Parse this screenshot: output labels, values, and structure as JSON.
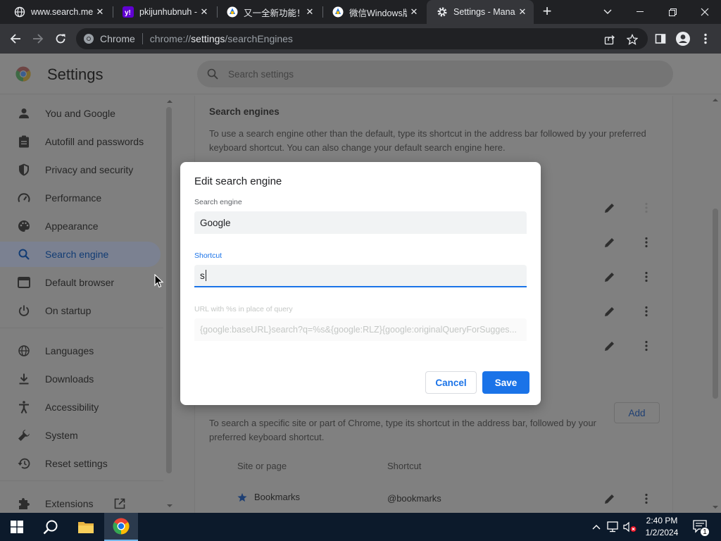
{
  "tabs": [
    {
      "title": "www.search.me",
      "icon": "globe-icon"
    },
    {
      "title": "pkijunhubnuh -",
      "icon": "yahoo-icon"
    },
    {
      "title": "又一全新功能！",
      "icon": "app-icon"
    },
    {
      "title": "微信Windows版",
      "icon": "app-icon"
    },
    {
      "title": "Settings - Mana",
      "icon": "gear-icon",
      "active": true
    }
  ],
  "toolbar": {
    "site_chip": "Chrome",
    "url_prefix": "chrome://",
    "url_host": "settings",
    "url_path": "/searchEngines"
  },
  "header": {
    "title": "Settings",
    "search_placeholder": "Search settings"
  },
  "sidebar": {
    "items": [
      {
        "label": "You and Google",
        "icon": "person-icon"
      },
      {
        "label": "Autofill and passwords",
        "icon": "clipboard-icon"
      },
      {
        "label": "Privacy and security",
        "icon": "shield-icon"
      },
      {
        "label": "Performance",
        "icon": "gauge-icon"
      },
      {
        "label": "Appearance",
        "icon": "palette-icon"
      },
      {
        "label": "Search engine",
        "icon": "search-icon",
        "selected": true
      },
      {
        "label": "Default browser",
        "icon": "browser-icon"
      },
      {
        "label": "On startup",
        "icon": "power-icon"
      },
      {
        "label": "Languages",
        "icon": "globe-icon"
      },
      {
        "label": "Downloads",
        "icon": "download-icon"
      },
      {
        "label": "Accessibility",
        "icon": "accessibility-icon"
      },
      {
        "label": "System",
        "icon": "wrench-icon"
      },
      {
        "label": "Reset settings",
        "icon": "reset-icon"
      },
      {
        "label": "Extensions",
        "icon": "puzzle-icon"
      }
    ]
  },
  "content": {
    "section_title": "Search engines",
    "description": "To use a search engine other than the default, type its shortcut in the address bar followed by your preferred keyboard shortcut. You can also change your default search engine here.",
    "add_label": "Add",
    "site_search_description": "To search a specific site or part of Chrome, type its shortcut in the address bar, followed by your preferred keyboard shortcut.",
    "col_site": "Site or page",
    "col_shortcut": "Shortcut",
    "bookmarks_row": {
      "name": "Bookmarks",
      "shortcut": "@bookmarks"
    }
  },
  "dialog": {
    "title": "Edit search engine",
    "engine_label": "Search engine",
    "engine_value": "Google",
    "shortcut_label": "Shortcut",
    "shortcut_value": "s",
    "url_label": "URL with %s in place of query",
    "url_value": "{google:baseURL}search?q=%s&{google:RLZ}{google:originalQueryForSugges...",
    "cancel_label": "Cancel",
    "save_label": "Save"
  },
  "taskbar": {
    "time": "2:40 PM",
    "date": "1/2/2024",
    "notification_count": "1"
  },
  "colors": {
    "accent": "#1a73e8",
    "tabstrip": "#202124",
    "toolbar": "#35363a",
    "taskbar": "#0c1a2b"
  }
}
